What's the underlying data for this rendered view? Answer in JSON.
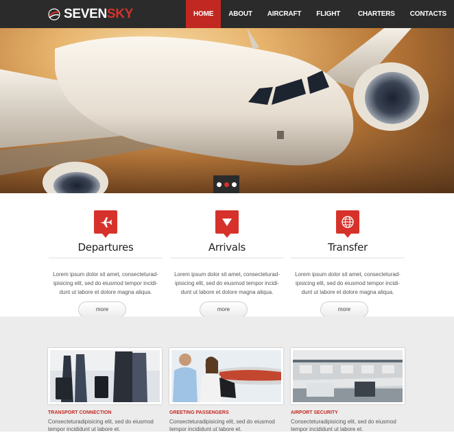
{
  "brand": {
    "name_part1": "SEVEN",
    "name_part2": "SKY",
    "accent_color": "#d6322b"
  },
  "nav": {
    "items": [
      {
        "label": "HOME",
        "active": true
      },
      {
        "label": "ABOUT",
        "active": false
      },
      {
        "label": "AIRCRAFT",
        "active": false
      },
      {
        "label": "FLIGHT INFO",
        "active": false
      },
      {
        "label": "CHARTERS",
        "active": false
      },
      {
        "label": "CONTACTS",
        "active": false
      }
    ]
  },
  "slider": {
    "dots": 3,
    "active_index": 1
  },
  "features": [
    {
      "icon": "airplane-icon",
      "title": "Departures",
      "text": "Lorem ipsum dolor sit amet, consecteturad-ipisicing elit, sed do eiusmod tempor incidi-dunt ut labore et dolore magna aliqua.",
      "button": "more"
    },
    {
      "icon": "arrow-down-icon",
      "title": "Arrivals",
      "text": "Lorem ipsum dolor sit amet, consecteturad-ipisicing elit, sed do eiusmod tempor incidi-dunt ut labore et dolore magna aliqua.",
      "button": "more"
    },
    {
      "icon": "globe-icon",
      "title": "Transfer",
      "text": "Lorem ipsum dolor sit amet, consecteturad-ipisicing elit, sed do eiusmod tempor incidi-dunt ut labore et dolore magna aliqua.",
      "button": "more"
    }
  ],
  "cards": [
    {
      "title": "TRANSPORT CONNECTION",
      "text": "Consecteturadipisicing elit, sed do eiusmod tempor incididunt ut labore et."
    },
    {
      "title": "GREETING PASSENGERS",
      "text": "Consecteturadipisicing elit, sed do eiusmod tempor incididunt ut labore et."
    },
    {
      "title": "AIRPORT SECURITY",
      "text": "Consecteturadipisicing elit, sed do eiusmod tempor incididunt ut labore et."
    }
  ]
}
